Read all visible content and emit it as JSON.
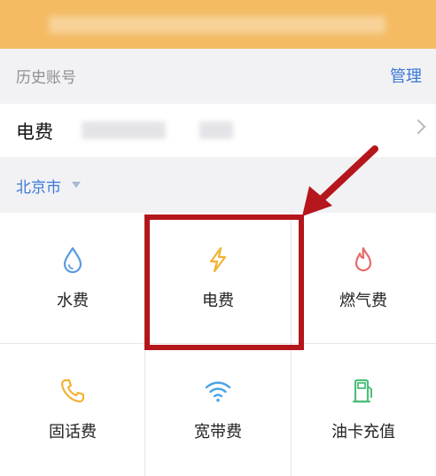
{
  "history": {
    "title": "历史账号",
    "manage_label": "管理"
  },
  "account": {
    "service_label": "电费"
  },
  "city": {
    "name": "北京市"
  },
  "services": [
    {
      "label": "水费",
      "icon": "water-drop-icon",
      "color": "#5a9be0"
    },
    {
      "label": "电费",
      "icon": "lightning-icon",
      "color": "#f2b233"
    },
    {
      "label": "燃气费",
      "icon": "flame-icon",
      "color": "#e76b6b"
    },
    {
      "label": "固话费",
      "icon": "phone-icon",
      "color": "#f2b233"
    },
    {
      "label": "宽带费",
      "icon": "wifi-icon",
      "color": "#4aa3e3"
    },
    {
      "label": "油卡充值",
      "icon": "fuel-pump-icon",
      "color": "#4fbf7a"
    }
  ],
  "colors": {
    "banner": "#f4bb63",
    "accent_blue": "#3a78d6",
    "highlight_red": "#b4161c"
  }
}
